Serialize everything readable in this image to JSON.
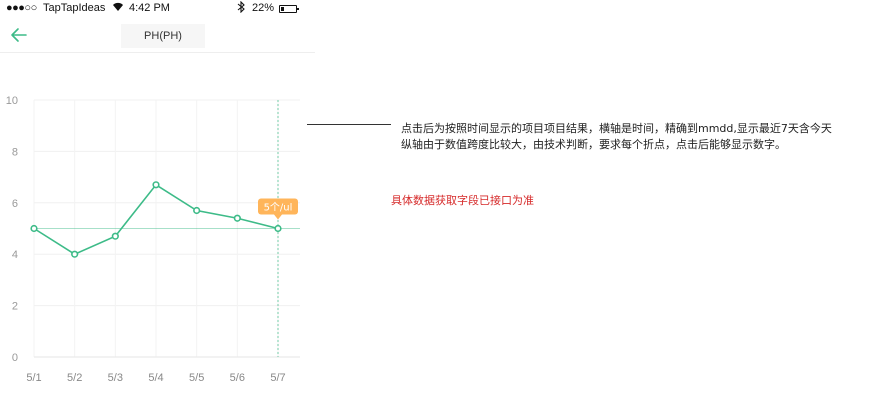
{
  "status_bar": {
    "signal": "●●●○○",
    "carrier": "TapTapIdeas",
    "wifi_icon": "wifi-icon",
    "time": "4:42 PM",
    "bluetooth_icon": "bluetooth-icon",
    "battery": "22%",
    "battery_level": 0.22
  },
  "nav": {
    "back_icon": "back-arrow-icon",
    "title": "PH(PH)"
  },
  "chart_data": {
    "type": "line",
    "categories": [
      "5/1",
      "5/2",
      "5/3",
      "5/4",
      "5/5",
      "5/6",
      "5/7"
    ],
    "series": [
      {
        "values": [
          5.0,
          4.0,
          4.7,
          6.7,
          5.7,
          5.4,
          5.0
        ]
      }
    ],
    "ylim": [
      0,
      10
    ],
    "yticks": [
      "10",
      "8",
      "6",
      "4",
      "2",
      "0"
    ],
    "grid": true,
    "selected_index": 6,
    "tooltip": "5个/ul",
    "line_color": "#3dbb88",
    "tooltip_color": "#ffb55a"
  },
  "notes": {
    "line1": "点击后为按照时间显示的项目项目结果，横轴是时间，精确到mmdd,显示最近7天含今天",
    "line2": "纵轴由于数值跨度比较大，由技术判断，要求每个折点，点击后能够显示数字。",
    "red_note": "具体数据获取字段已接口为准"
  }
}
